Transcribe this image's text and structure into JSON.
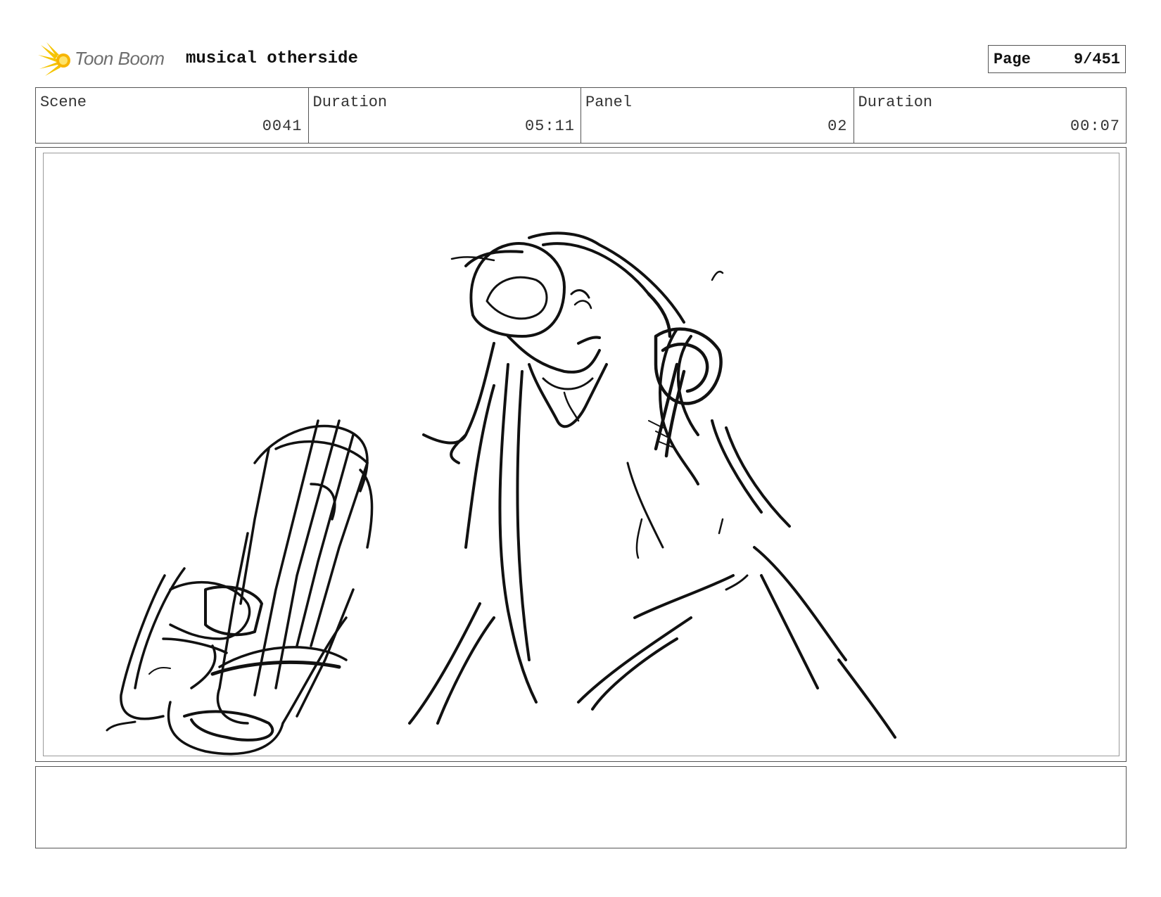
{
  "header": {
    "logo_text": "Toon Boom",
    "project_title": "musical otherside",
    "page_label": "Page",
    "page_value": "9/451"
  },
  "info": {
    "scene_label": "Scene",
    "scene_value": "0041",
    "scene_duration_label": "Duration",
    "scene_duration_value": "05:11",
    "panel_label": "Panel",
    "panel_value": "02",
    "panel_duration_label": "Duration",
    "panel_duration_value": "00:07"
  },
  "colors": {
    "logo_accent": "#f5c400",
    "sketch_ink": "#111111"
  }
}
